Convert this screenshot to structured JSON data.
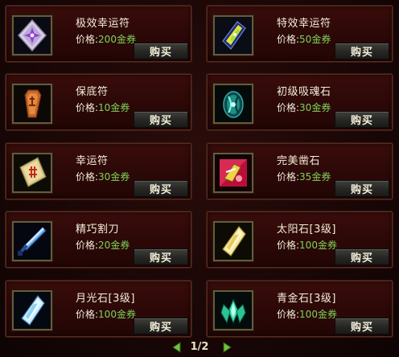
{
  "shop": {
    "items": [
      {
        "name": "极效幸运符",
        "price_label": "价格:",
        "price_value": "200金券",
        "buy_label": "购买",
        "icon": "purple-star-charm-icon"
      },
      {
        "name": "特效幸运符",
        "price_label": "价格:",
        "price_value": "50金券",
        "buy_label": "购买",
        "icon": "yellow-green-charm-icon"
      },
      {
        "name": "保底符",
        "price_label": "价格:",
        "price_value": "10金券",
        "buy_label": "购买",
        "icon": "orange-talisman-icon"
      },
      {
        "name": "初级吸魂石",
        "price_label": "价格:",
        "price_value": "30金券",
        "buy_label": "购买",
        "icon": "soul-stone-icon"
      },
      {
        "name": "幸运符",
        "price_label": "价格:",
        "price_value": "30金券",
        "buy_label": "购买",
        "icon": "luck-charm-icon"
      },
      {
        "name": "完美凿石",
        "price_label": "价格:",
        "price_value": "35金券",
        "buy_label": "购买",
        "icon": "chisel-stone-icon"
      },
      {
        "name": "精巧割刀",
        "price_label": "价格:",
        "price_value": "20金券",
        "buy_label": "购买",
        "icon": "blue-blade-icon"
      },
      {
        "name": "太阳石[3级]",
        "price_label": "价格:",
        "price_value": "100金券",
        "buy_label": "购买",
        "icon": "sun-crystal-icon"
      },
      {
        "name": "月光石[3级]",
        "price_label": "价格:",
        "price_value": "100金券",
        "buy_label": "购买",
        "icon": "moon-crystal-icon"
      },
      {
        "name": "青金石[3级]",
        "price_label": "价格:",
        "price_value": "100金券",
        "buy_label": "购买",
        "icon": "lapis-crystal-icon"
      }
    ]
  },
  "pager": {
    "text": "1/2",
    "prev_icon": "arrow-left-icon",
    "next_icon": "arrow-right-icon",
    "arrow_color": "#6fc23a"
  },
  "colors": {
    "price_value": "#7fd35a",
    "text": "#f2eed8",
    "card_bg": "#2b0807"
  }
}
